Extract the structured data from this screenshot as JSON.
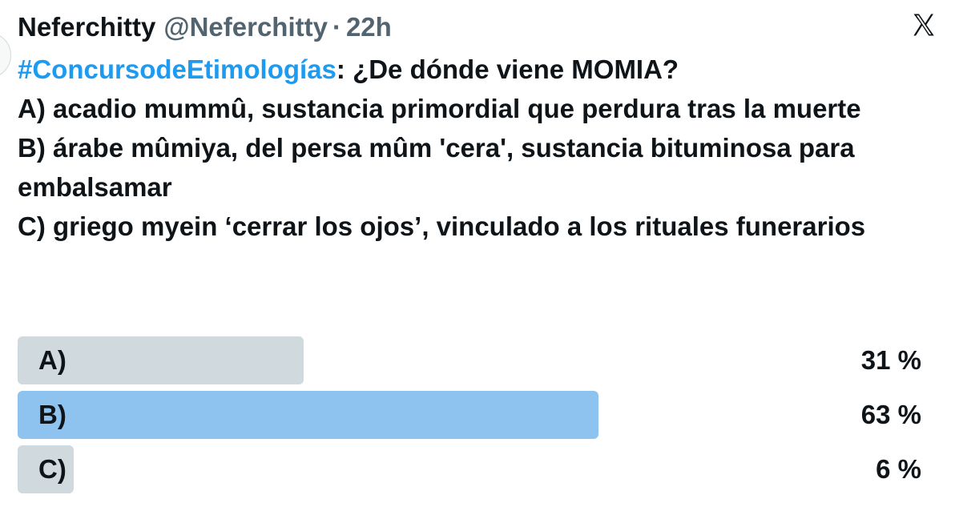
{
  "header": {
    "display_name": "Neferchitty",
    "handle": "@Neferchitty",
    "separator": "·",
    "time": "22h"
  },
  "icons": {
    "platform_logo": "x-logo-icon"
  },
  "tweet": {
    "hashtag": "#ConcursodeEtimologías",
    "question": ": ¿De dónde viene MOMIA?",
    "option_a": "A) acadio mummû, sustancia primordial que perdura tras la muerte",
    "option_b": "B) árabe mûmiya, del persa mûm 'cera', sustancia bituminosa para embalsamar",
    "option_c": "C) griego myein ‘cerrar los ojos’, vinculado a los rituales funerarios"
  },
  "poll": {
    "options": [
      {
        "label": "A)",
        "percent_text": "31 %",
        "percent": 31,
        "winner": false
      },
      {
        "label": "B)",
        "percent_text": "63 %",
        "percent": 63,
        "winner": true
      },
      {
        "label": "C)",
        "percent_text": "6 %",
        "percent": 6,
        "winner": false
      }
    ]
  },
  "colors": {
    "hashtag": "#1d9bf0",
    "winner_bar": "#8ec3f0",
    "other_bar": "#cfd9de",
    "secondary_text": "#536471"
  }
}
